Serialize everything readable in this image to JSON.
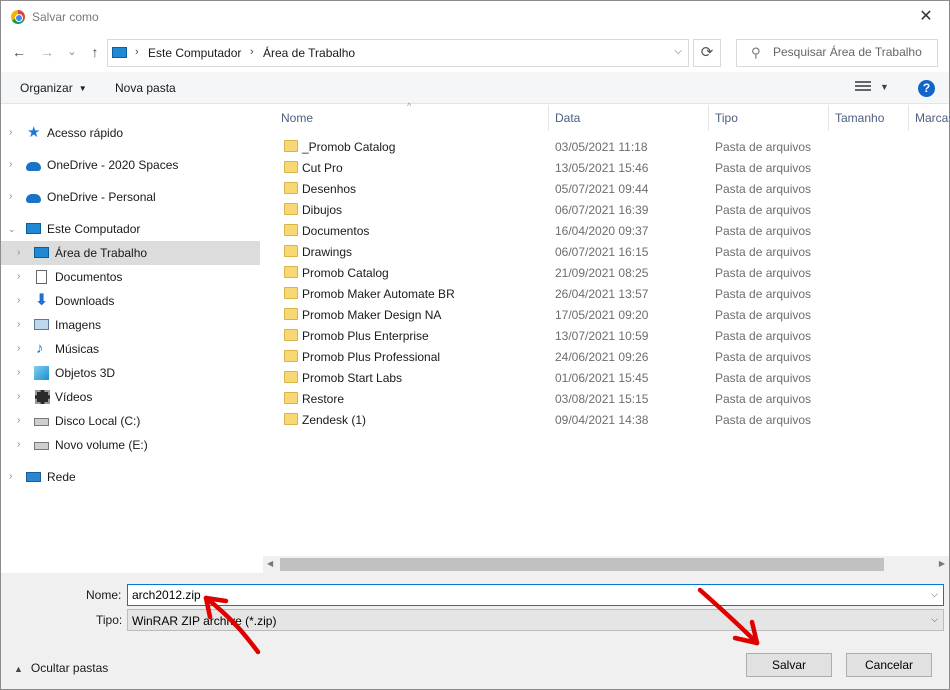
{
  "window": {
    "title": "Salvar como",
    "close_glyph": "✕"
  },
  "nav": {
    "back_glyph": "←",
    "forward_glyph": "→",
    "recent_glyph": "⌄",
    "up_glyph": "↑",
    "breadcrumb": [
      "Este Computador",
      "Área de Trabalho"
    ],
    "refresh_glyph": "⟳",
    "search_placeholder": "Pesquisar Área de Trabalho"
  },
  "toolbar": {
    "organize_label": "Organizar",
    "new_folder_label": "Nova pasta",
    "help_glyph": "?"
  },
  "sidebar": {
    "items": [
      {
        "label": "Acesso rápido",
        "icon": "star-icon"
      },
      {
        "label": "OneDrive - 2020 Spaces",
        "icon": "cloud-icon"
      },
      {
        "label": "OneDrive - Personal",
        "icon": "cloud-icon"
      },
      {
        "label": "Este Computador",
        "icon": "computer-icon"
      },
      {
        "label": "Área de Trabalho",
        "icon": "desktop-icon",
        "selected": true
      },
      {
        "label": "Documentos",
        "icon": "documents-icon"
      },
      {
        "label": "Downloads",
        "icon": "download-icon"
      },
      {
        "label": "Imagens",
        "icon": "pictures-icon"
      },
      {
        "label": "Músicas",
        "icon": "music-icon"
      },
      {
        "label": "Objetos 3D",
        "icon": "3d-objects-icon"
      },
      {
        "label": "Vídeos",
        "icon": "videos-icon"
      },
      {
        "label": "Disco Local (C:)",
        "icon": "local-disk-icon"
      },
      {
        "label": "Novo volume (E:)",
        "icon": "drive-icon"
      },
      {
        "label": "Rede",
        "icon": "network-icon"
      }
    ]
  },
  "columns": {
    "name": "Nome",
    "date": "Data",
    "type": "Tipo",
    "size": "Tamanho",
    "tags": "Marcas"
  },
  "files": [
    {
      "name": "_Promob Catalog",
      "date": "03/05/2021 11:18",
      "type": "Pasta de arquivos"
    },
    {
      "name": "Cut Pro",
      "date": "13/05/2021 15:46",
      "type": "Pasta de arquivos"
    },
    {
      "name": "Desenhos",
      "date": "05/07/2021 09:44",
      "type": "Pasta de arquivos"
    },
    {
      "name": "Dibujos",
      "date": "06/07/2021 16:39",
      "type": "Pasta de arquivos"
    },
    {
      "name": "Documentos",
      "date": "16/04/2020 09:37",
      "type": "Pasta de arquivos"
    },
    {
      "name": "Drawings",
      "date": "06/07/2021 16:15",
      "type": "Pasta de arquivos"
    },
    {
      "name": "Promob Catalog",
      "date": "21/09/2021 08:25",
      "type": "Pasta de arquivos"
    },
    {
      "name": "Promob Maker Automate BR",
      "date": "26/04/2021 13:57",
      "type": "Pasta de arquivos"
    },
    {
      "name": "Promob Maker Design NA",
      "date": "17/05/2021 09:20",
      "type": "Pasta de arquivos"
    },
    {
      "name": "Promob Plus Enterprise",
      "date": "13/07/2021 10:59",
      "type": "Pasta de arquivos"
    },
    {
      "name": "Promob Plus Professional",
      "date": "24/06/2021 09:26",
      "type": "Pasta de arquivos"
    },
    {
      "name": "Promob Start Labs",
      "date": "01/06/2021 15:45",
      "type": "Pasta de arquivos"
    },
    {
      "name": "Restore",
      "date": "03/08/2021 15:15",
      "type": "Pasta de arquivos"
    },
    {
      "name": "Zendesk (1)",
      "date": "09/04/2021 14:38",
      "type": "Pasta de arquivos"
    }
  ],
  "form": {
    "name_label": "Nome:",
    "name_value": "arch2012.zip",
    "type_label": "Tipo:",
    "type_value": "WinRAR ZIP archive (*.zip)",
    "hide_folders_label": "Ocultar pastas",
    "save_label": "Salvar",
    "cancel_label": "Cancelar"
  },
  "colors": {
    "accent": "#0078d7",
    "annotation": "#e00000",
    "selected_row": "#dcdcdc"
  }
}
